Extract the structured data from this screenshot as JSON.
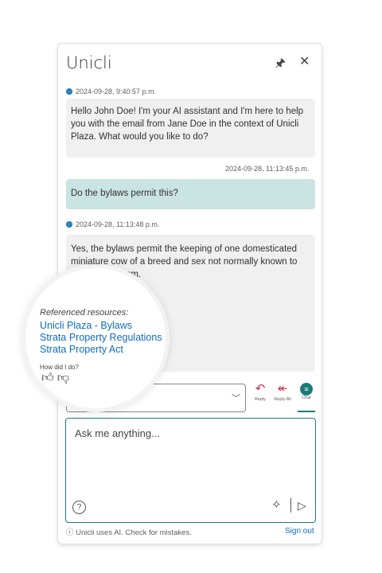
{
  "app": {
    "title": "Unicli",
    "pin_icon": "pin-icon",
    "close_icon": "close-icon"
  },
  "messages": [
    {
      "role": "assistant",
      "timestamp": "2024-09-28, 9:40:57 p.m.",
      "text": "Hello John Doe! I'm your AI assistant and I'm here to help you with the email from Jane Doe in the context of Unicli Plaza. What would you like to do?"
    },
    {
      "role": "user",
      "timestamp": "2024-09-28, 11:13:45 p.m.",
      "text": "Do the bylaws permit this?"
    },
    {
      "role": "assistant",
      "timestamp": "2024-09-28, 11:13:48 p.m.",
      "text": "Yes, the bylaws permit the keeping of one domesticated miniature cow of a breed and sex not normally known to taller than 90 cm."
    }
  ],
  "references": {
    "title": "Referenced resources:",
    "items": [
      "Unicli Plaza - Bylaws",
      "Strata Property Regulations",
      "Strata Property Act"
    ],
    "feedback_label": "How did I do?"
  },
  "actions": {
    "reply": "Reply",
    "reply_all": "Reply All",
    "chat": "Chat"
  },
  "composer": {
    "placeholder": "Ask me anything..."
  },
  "footer": {
    "disclaimer": "Unicli uses AI. Check for mistakes.",
    "sign_out": "Sign out"
  },
  "colors": {
    "accent": "#1b7a78",
    "user_bubble": "#c9e4e2",
    "link": "#0f6cbd",
    "reply": "#c4314b"
  }
}
